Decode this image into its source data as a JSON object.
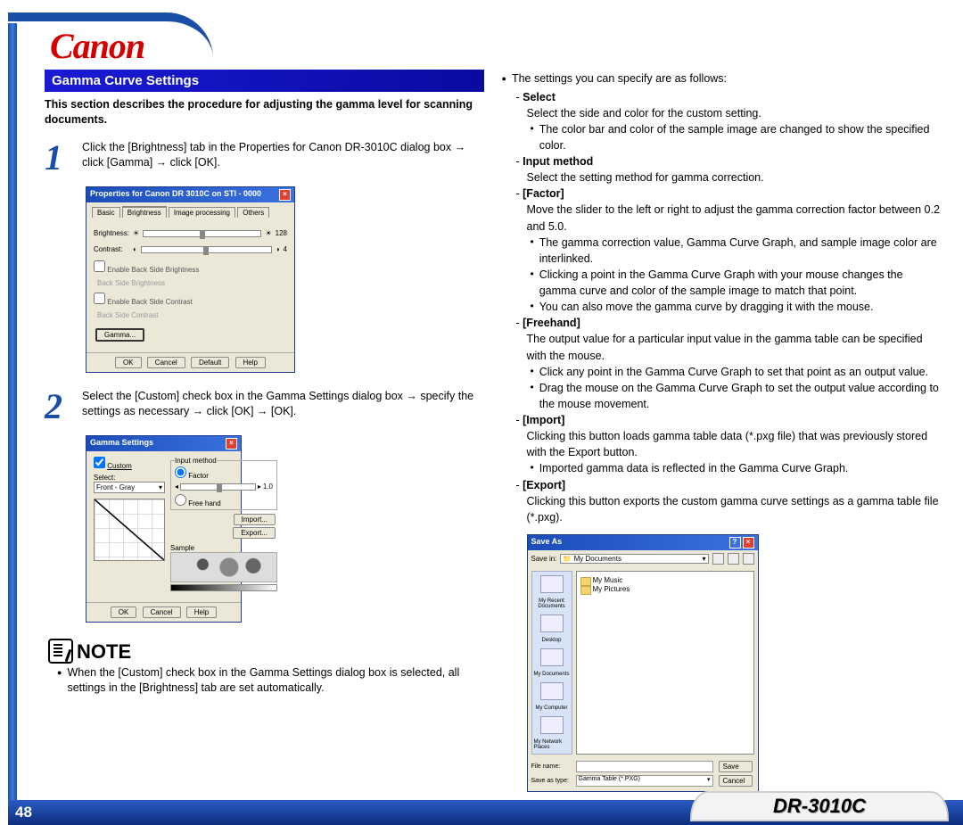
{
  "brand": "Canon",
  "page_number": "48",
  "model": "DR-3010C",
  "section_title": "Gamma Curve Settings",
  "intro": "This section describes the procedure for adjusting the gamma level for scanning documents.",
  "step1": {
    "num": "1",
    "text": "Click the [Brightness] tab in the Properties for Canon DR-3010C dialog box → click [Gamma] → click [OK]."
  },
  "step2": {
    "num": "2",
    "text": "Select the [Custom] check box in the Gamma Settings dialog box → specify the settings as necessary → click [OK] → [OK]."
  },
  "win_props": {
    "title": "Properties for Canon DR 3010C on STI - 0000",
    "tabs": [
      "Basic",
      "Brightness",
      "Image processing",
      "Others"
    ],
    "brightness_label": "Brightness:",
    "brightness_val": "128",
    "contrast_label": "Contrast:",
    "contrast_val": "4",
    "backside_brightness": "Enable Back Side Brightness",
    "backside_brightness_label": "Back Side Brightness",
    "backside_contrast": "Enable Back Side Contrast",
    "backside_contrast_label": "Back Side Contrast",
    "gamma_btn": "Gamma...",
    "ok": "OK",
    "cancel": "Cancel",
    "default": "Default",
    "help": "Help"
  },
  "win_gamma": {
    "title": "Gamma Settings",
    "custom": "Custom",
    "select_label": "Select:",
    "select_value": "Front - Gray",
    "input_method": "Input method",
    "factor": "Factor",
    "factor_val": "1.0",
    "freehand": "Free hand",
    "import": "Import...",
    "export": "Export...",
    "sample": "Sample",
    "ok": "OK",
    "cancel": "Cancel",
    "help": "Help"
  },
  "note_label": "NOTE",
  "note_text": "When the [Custom] check box in the Gamma Settings dialog box is selected, all settings in the [Brightness] tab are set automatically.",
  "right": {
    "intro": "The settings you can specify are as follows:",
    "select": {
      "title": "Select",
      "desc": "Select the side and color for the custom setting.",
      "b1": "The color bar and color of the sample image are changed to show the specified color."
    },
    "input": {
      "title": "Input method",
      "desc": "Select the setting method for gamma correction."
    },
    "factor": {
      "title": "[Factor]",
      "desc": "Move the slider to the left or right to adjust the gamma correction factor between 0.2 and 5.0.",
      "b1": "The gamma correction value, Gamma Curve Graph, and sample image color are interlinked.",
      "b2": "Clicking a point in the Gamma Curve Graph with your mouse changes the gamma curve and color of the sample image to match that point.",
      "b3": "You can also move the gamma curve by dragging it with the mouse."
    },
    "freehand": {
      "title": "[Freehand]",
      "desc": "The output value for a particular input value in the gamma table can be specified with the mouse.",
      "b1": "Click any point in the Gamma Curve Graph to set that point as an output value.",
      "b2": "Drag the mouse on the Gamma Curve Graph to set the output value according to the mouse movement."
    },
    "import": {
      "title": "[Import]",
      "desc": "Clicking this button loads gamma table data (*.pxg file) that was previously stored with the Export button.",
      "b1": "Imported gamma data is reflected in the Gamma Curve Graph."
    },
    "export": {
      "title": "[Export]",
      "desc": "Clicking this button exports the custom gamma curve settings as a gamma table file (*.pxg)."
    }
  },
  "win_save": {
    "title": "Save As",
    "savein_label": "Save in:",
    "savein_value": "My Documents",
    "places": [
      "My Recent Documents",
      "Desktop",
      "My Documents",
      "My Computer",
      "My Network Places"
    ],
    "folders": [
      "My Music",
      "My Pictures"
    ],
    "filename_label": "File name:",
    "filename_value": "",
    "savetype_label": "Save as type:",
    "savetype_value": "Gamma Table (*.PXG)",
    "save": "Save",
    "cancel": "Cancel"
  }
}
